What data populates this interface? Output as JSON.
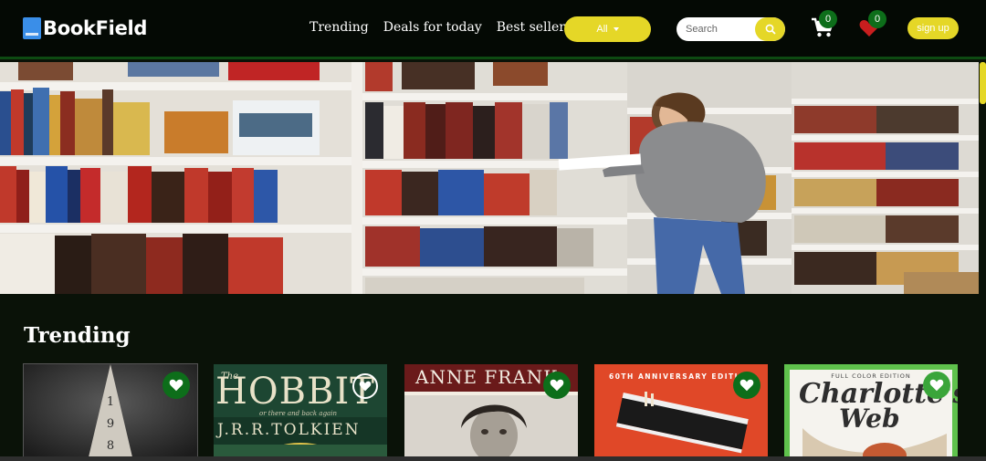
{
  "brand": {
    "name": "BookField",
    "accent": "#e5d727",
    "green": "#0d6e1a"
  },
  "nav": {
    "links": [
      "Trending",
      "Deals for today",
      "Best sellers"
    ],
    "filter_label": "All",
    "search_placeholder": "Search",
    "cart_count": "0",
    "wishlist_count": "0",
    "signup_label": "sign up"
  },
  "hero": {
    "icon": "bookstore-photo"
  },
  "trending": {
    "title": "Trending",
    "books": [
      {
        "cover_text": [
          "1",
          "9",
          "8"
        ]
      },
      {
        "title": "HOBBIT",
        "title_prefix": "The",
        "subtitle": "or there and back again",
        "author": "J.R.R.TOLKIEN"
      },
      {
        "title": "ANNE FRANK"
      },
      {
        "banner": "60TH ANNIVERSARY EDITION"
      },
      {
        "banner": "FULL COLOR EDITION",
        "title_line1": "Charlotte's",
        "title_line2": "Web"
      }
    ]
  }
}
